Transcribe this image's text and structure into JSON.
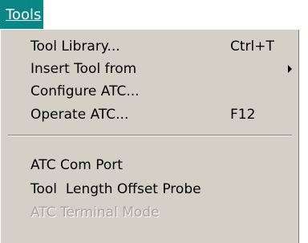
{
  "menubar": {
    "tools_label": "Tools"
  },
  "menu": {
    "items": [
      {
        "label": "Tool Library...",
        "shortcut": "Ctrl+T"
      },
      {
        "label": "Insert Tool from",
        "has_submenu": true
      },
      {
        "label": "Configure ATC..."
      },
      {
        "label": "Operate ATC...",
        "shortcut": "F12"
      },
      {
        "label": "ATC Com Port"
      },
      {
        "label": "Tool  Length Offset Probe"
      },
      {
        "label": "ATC Terminal Mode",
        "disabled": true
      }
    ]
  },
  "colors": {
    "menubar_highlight": "#0b8686",
    "menu_background": "#d4d0c8",
    "disabled_text": "#a9a59c"
  },
  "icons": {
    "submenu_arrow": "triangle-right-icon"
  }
}
